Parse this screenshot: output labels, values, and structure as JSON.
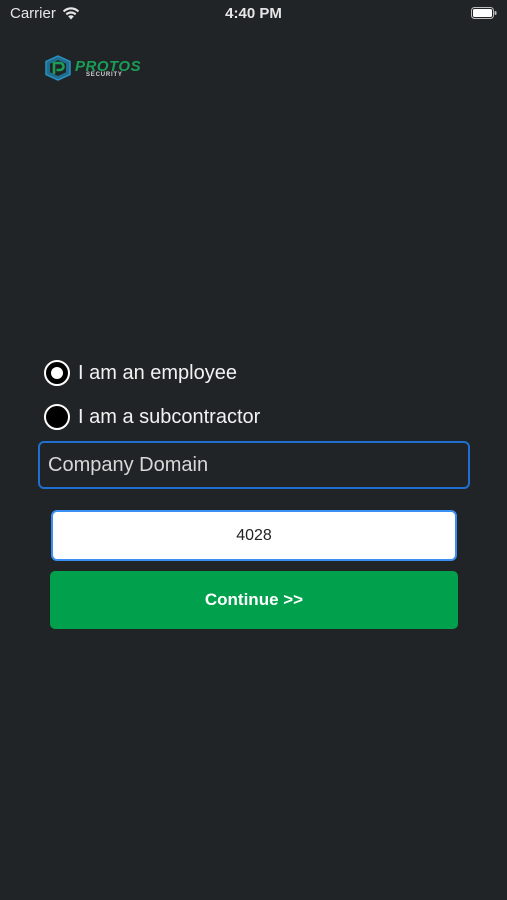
{
  "status_bar": {
    "carrier": "Carrier",
    "time": "4:40 PM"
  },
  "logo": {
    "word": "PROTOS",
    "subtitle": "SECURITY",
    "colors": {
      "primary": "#1a9e57",
      "accent": "#2b8fbf"
    }
  },
  "role_options": [
    {
      "label": "I am an employee",
      "selected": true
    },
    {
      "label": "I am a subcontractor",
      "selected": false
    }
  ],
  "company_domain": {
    "placeholder": "Company Domain",
    "value": ""
  },
  "code_input": {
    "value": "4028"
  },
  "continue_button": {
    "label": "Continue >>",
    "color": "#00a04c"
  },
  "colors": {
    "background": "#212426",
    "focus_border": "#1f6fce"
  }
}
